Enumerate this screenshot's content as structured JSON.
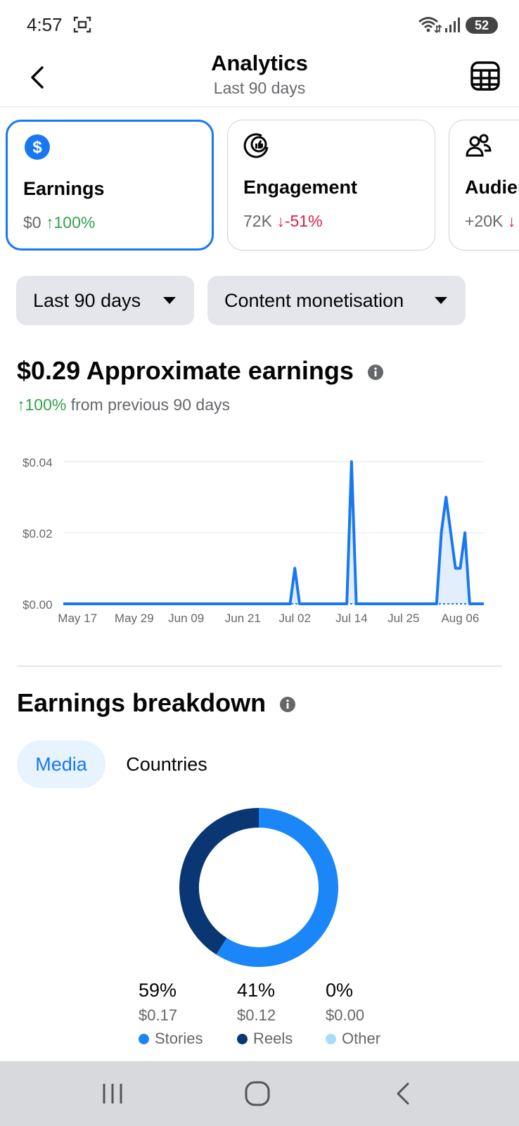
{
  "status_bar": {
    "time": "4:57",
    "battery": "52"
  },
  "header": {
    "title": "Analytics",
    "subtitle": "Last 90 days"
  },
  "cards": [
    {
      "label": "Earnings",
      "value": "$0",
      "change": "↑100%"
    },
    {
      "label": "Engagement",
      "value": "72K",
      "change": "↓-51%"
    },
    {
      "label": "Audience",
      "value": "+20K",
      "change": "↓"
    }
  ],
  "filters": {
    "period": "Last 90 days",
    "type": "Content monetisation"
  },
  "summary": {
    "value": "$0.29 Approximate earnings",
    "change": "↑100%",
    "change_suffix": " from previous 90 days"
  },
  "chart_data": {
    "type": "area",
    "x": [
      "May 14",
      "May 15",
      "May 16",
      "May 17",
      "May 18",
      "May 19",
      "May 20",
      "May 21",
      "May 22",
      "May 23",
      "May 24",
      "May 25",
      "May 26",
      "May 27",
      "May 28",
      "May 29",
      "May 30",
      "May 31",
      "Jun 01",
      "Jun 02",
      "Jun 03",
      "Jun 04",
      "Jun 05",
      "Jun 06",
      "Jun 07",
      "Jun 08",
      "Jun 09",
      "Jun 10",
      "Jun 11",
      "Jun 12",
      "Jun 13",
      "Jun 14",
      "Jun 15",
      "Jun 16",
      "Jun 17",
      "Jun 18",
      "Jun 19",
      "Jun 20",
      "Jun 21",
      "Jun 22",
      "Jun 23",
      "Jun 24",
      "Jun 25",
      "Jun 26",
      "Jun 27",
      "Jun 28",
      "Jun 29",
      "Jun 30",
      "Jul 01",
      "Jul 02",
      "Jul 03",
      "Jul 04",
      "Jul 05",
      "Jul 06",
      "Jul 07",
      "Jul 08",
      "Jul 09",
      "Jul 10",
      "Jul 11",
      "Jul 12",
      "Jul 13",
      "Jul 14",
      "Jul 15",
      "Jul 16",
      "Jul 17",
      "Jul 18",
      "Jul 19",
      "Jul 20",
      "Jul 21",
      "Jul 22",
      "Jul 23",
      "Jul 24",
      "Jul 25",
      "Jul 26",
      "Jul 27",
      "Jul 28",
      "Jul 29",
      "Jul 30",
      "Jul 31",
      "Aug 01",
      "Aug 02",
      "Aug 03",
      "Aug 04",
      "Aug 05",
      "Aug 06",
      "Aug 07",
      "Aug 08",
      "Aug 09",
      "Aug 10",
      "Aug 11"
    ],
    "values": [
      0,
      0,
      0,
      0,
      0,
      0,
      0,
      0,
      0,
      0,
      0,
      0,
      0,
      0,
      0,
      0,
      0,
      0,
      0,
      0,
      0,
      0,
      0,
      0,
      0,
      0,
      0,
      0,
      0,
      0,
      0,
      0,
      0,
      0,
      0,
      0,
      0,
      0,
      0,
      0,
      0,
      0,
      0,
      0,
      0,
      0,
      0,
      0,
      0,
      0.01,
      0,
      0,
      0,
      0,
      0,
      0,
      0,
      0,
      0,
      0,
      0,
      0.04,
      0,
      0,
      0,
      0,
      0,
      0,
      0,
      0,
      0,
      0,
      0,
      0,
      0,
      0,
      0,
      0,
      0,
      0,
      0.02,
      0.03,
      0.02,
      0.01,
      0.01,
      0.02,
      0,
      0,
      0,
      0
    ],
    "x_ticks": [
      "May 17",
      "May 29",
      "Jun 09",
      "Jun 21",
      "Jul 02",
      "Jul 14",
      "Jul 25",
      "Aug 06"
    ],
    "y_ticks": [
      "$0.00",
      "$0.02",
      "$0.04"
    ],
    "ylim": [
      0,
      0.04
    ],
    "grid": true,
    "color": "#1877f2"
  },
  "breakdown": {
    "title": "Earnings breakdown",
    "tabs": {
      "media": "Media",
      "countries": "Countries"
    },
    "items": [
      {
        "name": "Stories",
        "percent": "59%",
        "amount": "$0.17",
        "share": 59,
        "color": "#1b86f7"
      },
      {
        "name": "Reels",
        "percent": "41%",
        "amount": "$0.12",
        "share": 41,
        "color": "#0a3773"
      },
      {
        "name": "Other",
        "percent": "0%",
        "amount": "$0.00",
        "share": 0,
        "color": "#a8dcf8"
      }
    ]
  },
  "colors": {
    "accent": "#1877f2",
    "positive": "#31a24c",
    "negative": "#e41e3f"
  }
}
